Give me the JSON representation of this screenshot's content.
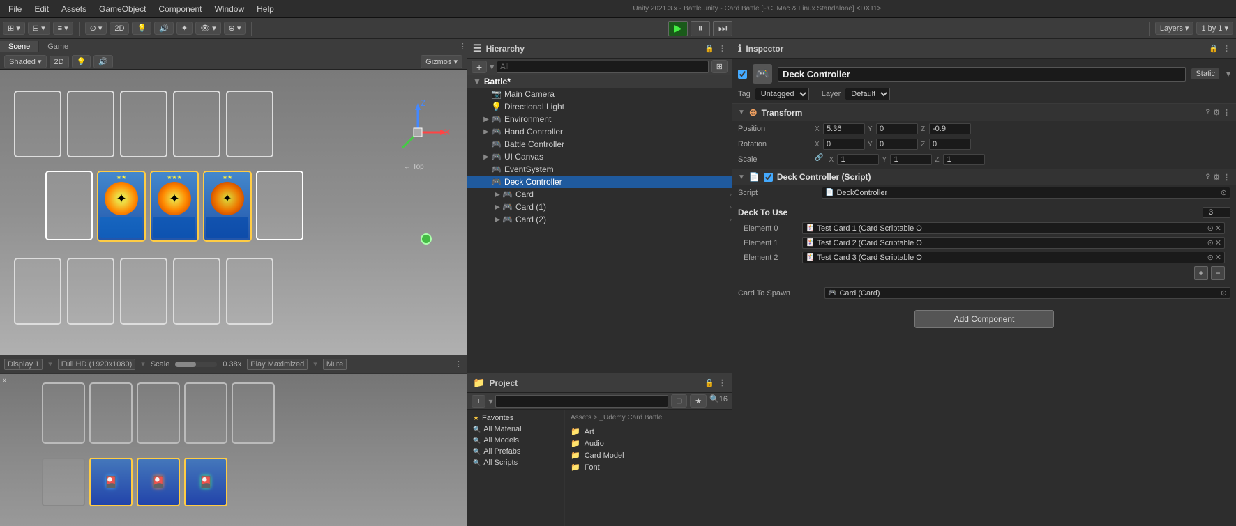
{
  "unity": {
    "topbar": {
      "title": "Unity 2021.3.x - Battle.unity - Card Battle [PC, Mac & Linux Standalone] <DX11>"
    },
    "menus": [
      "File",
      "Edit",
      "Assets",
      "GameObject",
      "Component",
      "Window",
      "Help"
    ]
  },
  "toolbar": {
    "play_label": "▶",
    "pause_label": "⏸",
    "step_label": "⏭",
    "display_label": "Display 1",
    "resolution_label": "Full HD (1920x1080)",
    "scale_label": "Scale",
    "scale_value": "0.38x",
    "play_mode_label": "Play Maximized",
    "mute_label": "Mute"
  },
  "scene": {
    "tab_label": "Scene",
    "game_tab_label": "Game",
    "top_label": "← Top",
    "gizmo_x": "X",
    "gizmo_z": "Z"
  },
  "hierarchy": {
    "panel_title": "Hierarchy",
    "search_placeholder": "All",
    "scene_name": "Battle*",
    "items": [
      {
        "id": "main-camera",
        "label": "Main Camera",
        "indent": 1,
        "icon": "📷",
        "has_arrow": false
      },
      {
        "id": "directional-light",
        "label": "Directional Light",
        "indent": 1,
        "icon": "💡",
        "has_arrow": false
      },
      {
        "id": "environment",
        "label": "Environment",
        "indent": 1,
        "icon": "🎮",
        "has_arrow": true
      },
      {
        "id": "hand-controller",
        "label": "Hand Controller",
        "indent": 1,
        "icon": "🎮",
        "has_arrow": true
      },
      {
        "id": "battle-controller",
        "label": "Battle Controller",
        "indent": 1,
        "icon": "🎮",
        "has_arrow": false
      },
      {
        "id": "ui-canvas",
        "label": "UI Canvas",
        "indent": 1,
        "icon": "🎮",
        "has_arrow": true
      },
      {
        "id": "event-system",
        "label": "EventSystem",
        "indent": 1,
        "icon": "🎮",
        "has_arrow": false
      },
      {
        "id": "deck-controller",
        "label": "Deck Controller",
        "indent": 1,
        "icon": "🎮",
        "has_arrow": false,
        "selected": true
      },
      {
        "id": "card",
        "label": "Card",
        "indent": 2,
        "icon": "🎮",
        "has_arrow": true
      },
      {
        "id": "card-1",
        "label": "Card (1)",
        "indent": 2,
        "icon": "🎮",
        "has_arrow": true
      },
      {
        "id": "card-2",
        "label": "Card (2)",
        "indent": 2,
        "icon": "🎮",
        "has_arrow": true
      }
    ]
  },
  "inspector": {
    "panel_title": "Inspector",
    "object_name": "Deck Controller",
    "static_label": "Static",
    "tag_label": "Tag",
    "tag_value": "Untagged",
    "layer_label": "Layer",
    "layer_value": "Default",
    "transform": {
      "label": "Transform",
      "position_label": "Position",
      "pos_x": "5.36",
      "pos_y": "0",
      "pos_z": "-0.9",
      "rotation_label": "Rotation",
      "rot_x": "0",
      "rot_y": "0",
      "rot_z": "0",
      "scale_label": "Scale",
      "scale_x": "1",
      "scale_y": "1",
      "scale_z": "1"
    },
    "script_component": {
      "label": "Deck Controller (Script)",
      "script_label": "Script",
      "script_value": "DeckController"
    },
    "deck_to_use": {
      "label": "Deck To Use",
      "count": "3",
      "elements": [
        {
          "label": "Element 0",
          "value": "Test Card 1 (Card Scriptable O"
        },
        {
          "label": "Element 1",
          "value": "Test Card 2 (Card Scriptable O"
        },
        {
          "label": "Element 2",
          "value": "Test Card 3 (Card Scriptable O"
        }
      ]
    },
    "card_to_spawn": {
      "label": "Card To Spawn",
      "value": "Card (Card)"
    },
    "add_component_label": "Add Component"
  },
  "project": {
    "panel_title": "Project",
    "search_placeholder": "",
    "breadcrumb": "Assets > _Udemy Card Battle",
    "favorites": [
      {
        "label": "Favorites",
        "is_header": true
      },
      {
        "label": "All Material"
      },
      {
        "label": "All Models"
      },
      {
        "label": "All Prefabs"
      },
      {
        "label": "All Scripts"
      }
    ],
    "folders": [
      {
        "label": "Art"
      },
      {
        "label": "Audio"
      },
      {
        "label": "Card Model"
      },
      {
        "label": "Font"
      }
    ]
  },
  "colors": {
    "selected_blue": "#1f5a9e",
    "accent_blue": "#4488cc",
    "gold": "#ffcc44",
    "bg_dark": "#2d2d2d",
    "bg_mid": "#3c3c3c",
    "bg_scene": "#888888"
  }
}
